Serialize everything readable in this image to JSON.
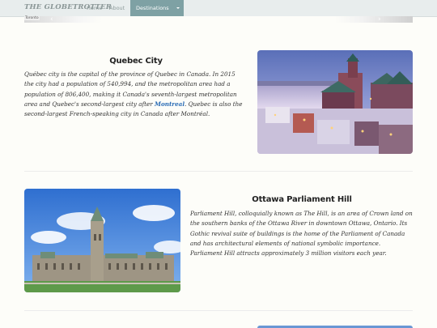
{
  "navbar": {
    "brand": "THE GLOBETROTTER",
    "links": [
      {
        "label": "Home"
      },
      {
        "label": "About"
      },
      {
        "label": "Destinations"
      }
    ]
  },
  "carousel": {
    "image_alt": "Toronto"
  },
  "sections": [
    {
      "title": "Quebec City",
      "text_before_link": "Québec city is the capital of the province of Quebec in Canada. In 2015 the city had a population of 540,994, and the metropolitan area had a population of 806,400, making it Canada's seventh-largest metropolitan area and Quebec's second-largest city after ",
      "link_text": "Montreal",
      "text_after_link": ". Quebec is also the second-largest French-speaking city in Canada after Montréal."
    },
    {
      "title": "Ottawa Parliament Hill",
      "text": "Parliament Hill, colloquially known as The Hill, is an area of Crown land on the southern banks of the Ottawa River in downtown Ottawa, Ontario. Its Gothic revival suite of buildings is the home of the Parliament of Canada and has architectural elements of national symbolic importance. Parliament Hill attracts approximately 3 million visitors each year."
    }
  ],
  "colors": {
    "navbar_bg": "#e8eded",
    "nav_active_bg": "#7ea1a4",
    "link": "#2a6cb5"
  }
}
